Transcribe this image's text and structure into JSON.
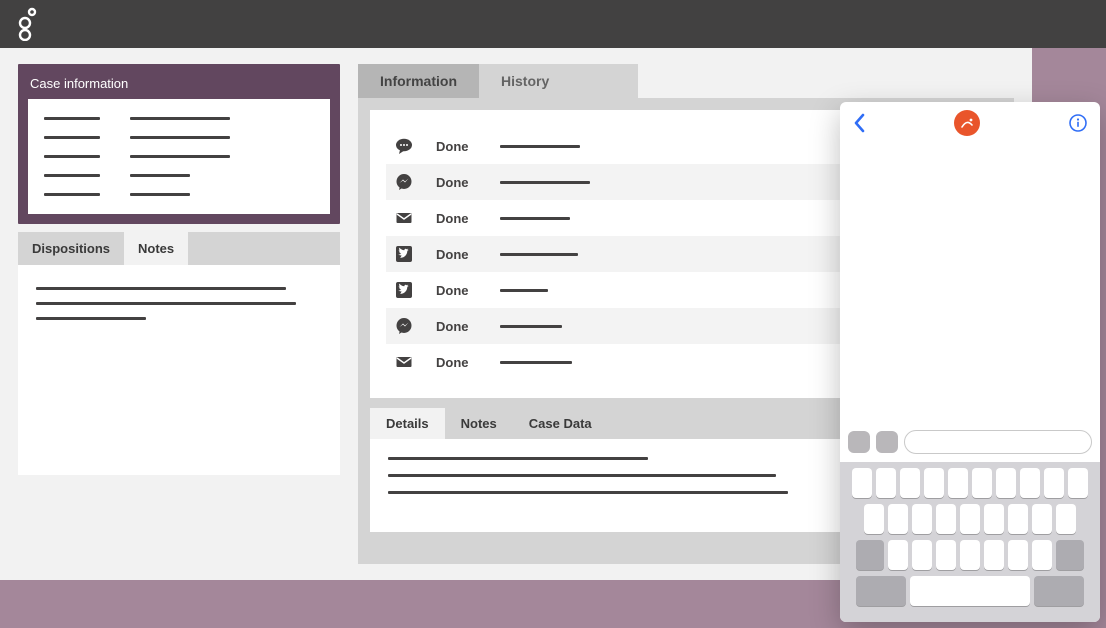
{
  "header": {},
  "case": {
    "title": "Case information"
  },
  "left_tabs": {
    "items": [
      "Dispositions",
      "Notes"
    ],
    "active": 1
  },
  "main_tabs": {
    "items": [
      "Information",
      "History"
    ],
    "active": 0
  },
  "info_rows": [
    {
      "icon": "chat",
      "status": "Done",
      "bar": 80
    },
    {
      "icon": "messenger",
      "status": "Done",
      "bar": 90
    },
    {
      "icon": "mail",
      "status": "Done",
      "bar": 70
    },
    {
      "icon": "twitter",
      "status": "Done",
      "bar": 78
    },
    {
      "icon": "twitter",
      "status": "Done",
      "bar": 48
    },
    {
      "icon": "messenger",
      "status": "Done",
      "bar": 62
    },
    {
      "icon": "mail",
      "status": "Done",
      "bar": 72
    }
  ],
  "detail_tabs": {
    "items": [
      "Details",
      "Notes",
      "Case Data"
    ],
    "active": 0
  },
  "detail_lines": [
    260,
    388,
    400
  ],
  "colors": {
    "brand": "#62475f",
    "accent": "#e9552b",
    "ios_blue": "#2f6df6"
  }
}
